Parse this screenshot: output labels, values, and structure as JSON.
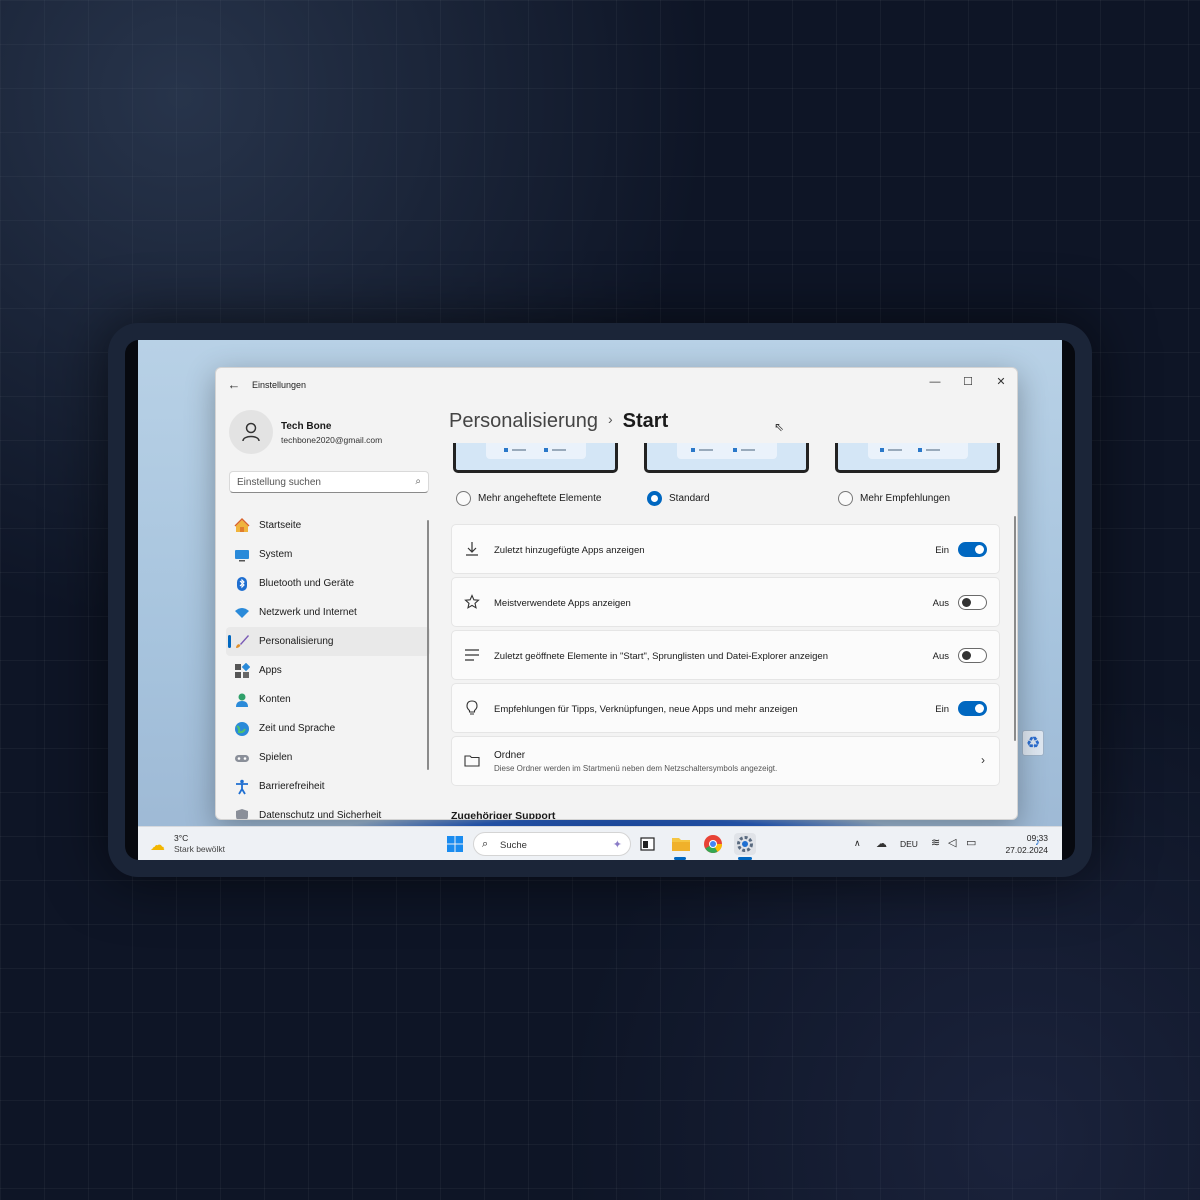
{
  "window": {
    "title": "Einstellungen",
    "controls": {
      "minimize": "—",
      "maximize": "☐",
      "close": "✕"
    }
  },
  "user": {
    "name": "Tech Bone",
    "email": "techbone2020@gmail.com"
  },
  "search": {
    "placeholder": "Einstellung suchen"
  },
  "sidebar": {
    "items": [
      {
        "label": "Startseite",
        "icon": "home-icon"
      },
      {
        "label": "System",
        "icon": "monitor-icon"
      },
      {
        "label": "Bluetooth und Geräte",
        "icon": "bluetooth-icon"
      },
      {
        "label": "Netzwerk und Internet",
        "icon": "wifi-icon"
      },
      {
        "label": "Personalisierung",
        "icon": "brush-icon",
        "active": true
      },
      {
        "label": "Apps",
        "icon": "apps-icon"
      },
      {
        "label": "Konten",
        "icon": "person-icon"
      },
      {
        "label": "Zeit und Sprache",
        "icon": "globe-clock-icon"
      },
      {
        "label": "Spielen",
        "icon": "gamepad-icon"
      },
      {
        "label": "Barrierefreiheit",
        "icon": "accessibility-icon"
      },
      {
        "label": "Datenschutz und Sicherheit",
        "icon": "shield-icon"
      }
    ]
  },
  "breadcrumb": {
    "parent": "Personalisierung",
    "separator": "›",
    "current": "Start"
  },
  "layout_options": {
    "selected": "Standard",
    "options": [
      "Mehr angeheftete Elemente",
      "Standard",
      "Mehr Empfehlungen"
    ]
  },
  "settings": [
    {
      "label": "Zuletzt hinzugefügte Apps anzeigen",
      "state": "Ein",
      "on": true,
      "icon": "download-icon"
    },
    {
      "label": "Meistverwendete Apps anzeigen",
      "state": "Aus",
      "on": false,
      "icon": "star-icon"
    },
    {
      "label": "Zuletzt geöffnete Elemente in \"Start\", Sprunglisten und Datei-Explorer anzeigen",
      "state": "Aus",
      "on": false,
      "icon": "list-icon"
    },
    {
      "label": "Empfehlungen für Tipps, Verknüpfungen, neue Apps und mehr anzeigen",
      "state": "Ein",
      "on": true,
      "icon": "lightbulb-icon"
    }
  ],
  "folders": {
    "title": "Ordner",
    "description": "Diese Ordner werden im Startmenü neben dem Netzschaltersymbols angezeigt.",
    "icon": "folder-icon"
  },
  "related_support": {
    "heading": "Zugehöriger Support"
  },
  "taskbar": {
    "weather": {
      "temp": "3°C",
      "desc": "Stark bewölkt"
    },
    "search_label": "Suche",
    "language": "DEU",
    "time": "09:33",
    "date": "27.02.2024",
    "apps": [
      "start-icon",
      "tv-icon",
      "file-explorer-icon",
      "chrome-icon",
      "settings-gear-icon"
    ]
  },
  "colors": {
    "accent": "#0067c0",
    "window_bg": "#f3f3f3",
    "card_bg": "#fbfbfb"
  }
}
